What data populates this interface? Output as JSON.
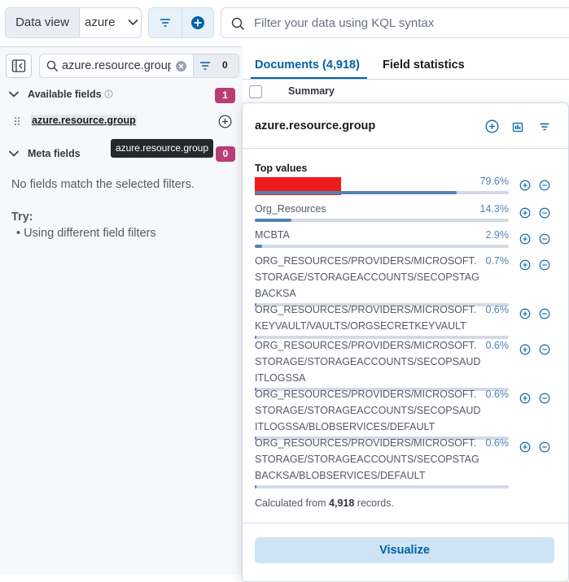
{
  "topbar": {
    "data_view_label": "Data view",
    "data_view_value": "azure",
    "search_placeholder": "Filter your data using KQL syntax"
  },
  "sidebar": {
    "field_search_value": "azure.resource.group",
    "filter_count": "0",
    "available_fields": {
      "label": "Available fields",
      "count": "1"
    },
    "field": {
      "name": "azure.resource.group"
    },
    "meta_fields": {
      "label": "Meta fields",
      "count": "0"
    },
    "empty_message": "No fields match the selected filters.",
    "try_label": "Try:",
    "try_item": "Using different field filters"
  },
  "tooltip": "azure.resource.group",
  "tabs": {
    "documents": "Documents (4,918)",
    "field_statistics": "Field statistics"
  },
  "table": {
    "summary_header": "Summary"
  },
  "popover": {
    "title": "azure.resource.group",
    "top_values_label": "Top values",
    "values": [
      {
        "label": "",
        "pct": "79.6%",
        "fraction": 0.796
      },
      {
        "label": "Org_Resources",
        "pct": "14.3%",
        "fraction": 0.143
      },
      {
        "label": "MCBTA",
        "pct": "2.9%",
        "fraction": 0.029
      },
      {
        "label": "ORG_RESOURCES/PROVIDERS/MICROSOFT.STORAGE/STORAGEACCOUNTS/SECOPSTAGBACKSA",
        "pct": "0.7%",
        "fraction": 0.007
      },
      {
        "label": "ORG_RESOURCES/PROVIDERS/MICROSOFT.KEYVAULT/VAULTS/ORGSECRETKEYVAULT",
        "pct": "0.6%",
        "fraction": 0.006
      },
      {
        "label": "ORG_RESOURCES/PROVIDERS/MICROSOFT.STORAGE/STORAGEACCOUNTS/SECOPSAUDITLOGSSA",
        "pct": "0.6%",
        "fraction": 0.006
      },
      {
        "label": "ORG_RESOURCES/PROVIDERS/MICROSOFT.STORAGE/STORAGEACCOUNTS/SECOPSAUDITLOGSSA/BLOBSERVICES/DEFAULT",
        "pct": "0.6%",
        "fraction": 0.006
      },
      {
        "label": "ORG_RESOURCES/PROVIDERS/MICROSOFT.STORAGE/STORAGEACCOUNTS/SECOPSTAGBACKSA/BLOBSERVICES/DEFAULT",
        "pct": "0.6%",
        "fraction": 0.006
      }
    ],
    "calc_prefix": "Calculated from",
    "calc_count": "4,918",
    "calc_suffix": "records.",
    "visualize_label": "Visualize"
  },
  "colors": {
    "accent": "#0061a6",
    "badge": "#ba3d76",
    "bar": "#5482b4"
  }
}
